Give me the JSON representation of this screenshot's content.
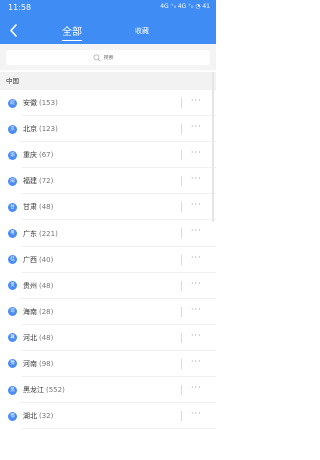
{
  "status_bar": {
    "time": "11:58",
    "icons_text": "4G ⁺ᵢₗ 4G ⁺ᵢₗ ◔ 41"
  },
  "nav": {
    "back_icon": "chevron-left-icon",
    "title": "全部",
    "favorite": "收藏"
  },
  "search": {
    "placeholder": "搜索",
    "icon": "search-icon"
  },
  "section": {
    "label": "中国"
  },
  "items": [
    {
      "badge": "皖",
      "name": "安徽",
      "count": "(153)"
    },
    {
      "badge": "京",
      "name": "北京",
      "count": "(123)"
    },
    {
      "badge": "渝",
      "name": "重庆",
      "count": "(67)"
    },
    {
      "badge": "闽",
      "name": "福建",
      "count": "(72)"
    },
    {
      "badge": "甘",
      "name": "甘肃",
      "count": "(48)"
    },
    {
      "badge": "粤",
      "name": "广东",
      "count": "(221)"
    },
    {
      "badge": "桂",
      "name": "广西",
      "count": "(40)"
    },
    {
      "badge": "贵",
      "name": "贵州",
      "count": "(48)"
    },
    {
      "badge": "琼",
      "name": "海南",
      "count": "(28)"
    },
    {
      "badge": "冀",
      "name": "河北",
      "count": "(48)"
    },
    {
      "badge": "豫",
      "name": "河南",
      "count": "(98)"
    },
    {
      "badge": "黑",
      "name": "黑龙江",
      "count": "(552)"
    },
    {
      "badge": "鄂",
      "name": "湖北",
      "count": "(32)"
    }
  ],
  "more_label": "···",
  "colors": {
    "header": "#3f8cf4",
    "badge": "#4a8cf0"
  }
}
